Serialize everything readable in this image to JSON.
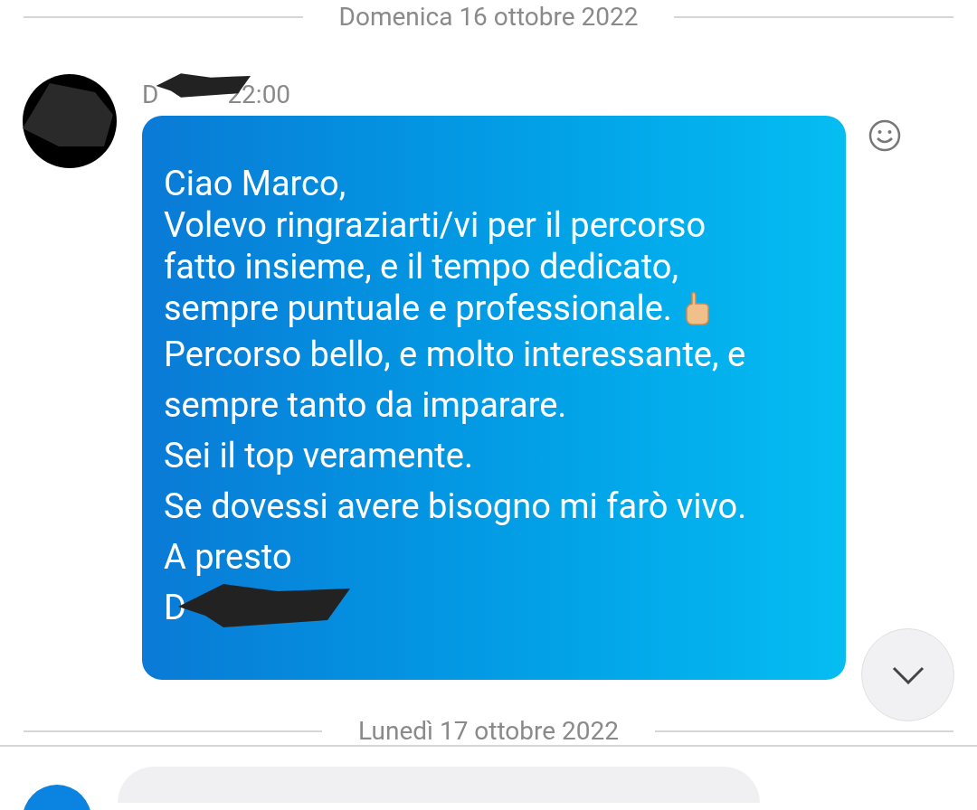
{
  "date_separators": [
    "Domenica 16 ottobre 2022",
    "Lunedì 17 ottobre 2022"
  ],
  "message": {
    "sender": "D",
    "time": "22:00",
    "lines": [
      {
        "text": "Ciao Marco,",
        "emoji": false
      },
      {
        "text": "Volevo ringraziarti/vi per il percorso",
        "emoji": false
      },
      {
        "text": "fatto insieme, e il tempo dedicato,",
        "emoji": false
      },
      {
        "text": "sempre puntuale e professionale.",
        "emoji": true
      },
      {
        "text": "Percorso bello, e molto interessante, e",
        "emoji": false
      },
      {
        "text": "sempre tanto da imparare.",
        "emoji": false
      },
      {
        "text": "Sei il top veramente.",
        "emoji": false
      },
      {
        "text": "Se dovessi avere bisogno mi farò vivo.",
        "emoji": false
      },
      {
        "text": "A presto",
        "emoji": false
      },
      {
        "text": "D",
        "emoji": false
      }
    ]
  }
}
